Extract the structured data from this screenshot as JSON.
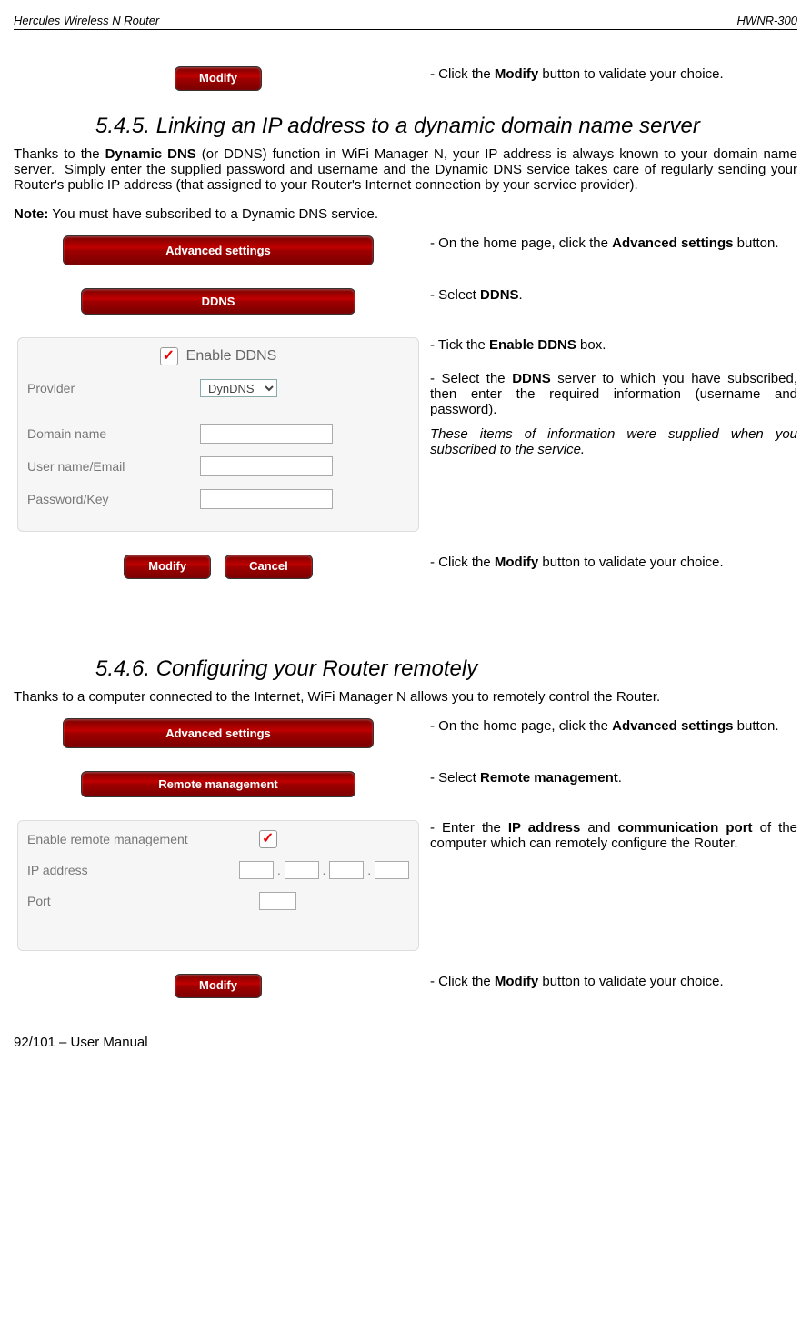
{
  "header": {
    "left": "Hercules Wireless N Router",
    "right": "HWNR-300"
  },
  "section545": {
    "modify_click": "- Click the Modify button to validate your choice.",
    "heading": "5.4.5. Linking an IP address to a dynamic domain name server",
    "intro": "Thanks to the Dynamic DNS (or DDNS) function in WiFi Manager N, your IP address is always known to your domain name server.  Simply enter the supplied password and username and the Dynamic DNS service takes care of regularly sending your Router's public IP address (that assigned to your Router's Internet connection by your service provider).",
    "note": "Note: You must have subscribed to a Dynamic DNS service.",
    "on_home": "- On the home page, click the Advanced settings button.",
    "select_ddns": "- Select DDNS.",
    "tick_enable": "- Tick the Enable DDNS box.",
    "select_server": "- Select the DDNS server to which you have subscribed, then enter the required information (username and password).",
    "supplied_info": "These items of information were supplied when you subscribed to the service.",
    "modify_click2": "- Click the Modify button to validate your choice."
  },
  "buttons": {
    "modify": "Modify",
    "advanced_settings": "Advanced settings",
    "ddns": "DDNS",
    "cancel": "Cancel",
    "remote_management": "Remote management"
  },
  "ddns_form": {
    "enable_label": "Enable DDNS",
    "provider_label": "Provider",
    "provider_value": "DynDNS",
    "domain_label": "Domain name",
    "username_label": "User name/Email",
    "password_label": "Password/Key"
  },
  "section546": {
    "heading": "5.4.6. Configuring your Router remotely",
    "intro": "Thanks to a computer connected to the Internet, WiFi Manager N allows you to remotely control the Router.",
    "on_home": "- On the home page, click the Advanced settings button.",
    "select_remote": "- Select Remote management.",
    "enter_ip": "- Enter the IP address and communication port of the computer which can remotely configure the Router.",
    "modify_click": "- Click the Modify button to validate your choice."
  },
  "remote_form": {
    "enable_label": "Enable remote management",
    "ip_label": "IP address",
    "port_label": "Port"
  },
  "footer": "92/101 – User Manual"
}
